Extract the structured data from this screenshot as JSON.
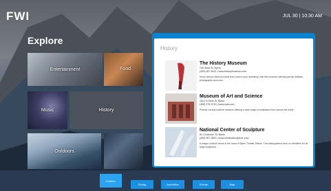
{
  "brand": {
    "logo_text": "FWI"
  },
  "header": {
    "datetime": "JUL 30 | 10:30 AM"
  },
  "explore": {
    "title": "Explore",
    "tiles": [
      {
        "label": "Entertainment"
      },
      {
        "label": "Food"
      },
      {
        "label": "Music"
      },
      {
        "label": "History"
      },
      {
        "label": "Outdoors"
      }
    ]
  },
  "panel": {
    "heading": "History",
    "entries": [
      {
        "name": "The History Museum",
        "address": "700 West St, Byers",
        "contact": "(405) 367-8421 | www.historymuseum.com",
        "description": "Know Various Museum ideas from past to your stranding! Visit this museum offering special artifacts, photography and more."
      },
      {
        "name": "Museum of Art and Science",
        "address": "1512 N Sixth St, Byers",
        "contact": "(405) 375-9740 | www.mas.com",
        "description": "Premier art and science museum offering a wide range of exhibitions from across the world."
      },
      {
        "name": "National Center of Sculpture",
        "address": "61 Crossover St, Byers",
        "contact": "(405) 367-9822 | www.centerofsculpture.com",
        "description": "A unique outdoor venue in the heart of Byers Theater District. This distinguished work on exhibition for its large sculptures."
      }
    ]
  },
  "bottom_nav": [
    {
      "label": "Explore"
    },
    {
      "label": "Dining"
    },
    {
      "label": "Amenities"
    },
    {
      "label": "Events"
    },
    {
      "label": "Map"
    }
  ]
}
